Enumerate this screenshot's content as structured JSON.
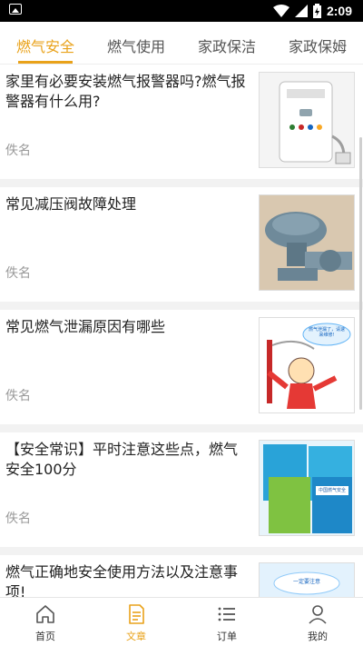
{
  "status_bar": {
    "time": "2:09"
  },
  "tabs": [
    {
      "label": "燃气安全",
      "active": true
    },
    {
      "label": "燃气使用",
      "active": false
    },
    {
      "label": "家政保洁",
      "active": false
    },
    {
      "label": "家政保姆",
      "active": false
    }
  ],
  "articles": [
    {
      "title": "家里有必要安装燃气报警器吗?燃气报警器有什么用?",
      "author": "佚名",
      "thumb": "gas-alarm-photo"
    },
    {
      "title": "常见减压阀故障处理",
      "author": "佚名",
      "thumb": "pressure-valve-photo"
    },
    {
      "title": "常见燃气泄漏原因有哪些",
      "author": "佚名",
      "thumb": "gas-leak-cartoon",
      "thumb_text": "燃气泄漏了，请速来维修!"
    },
    {
      "title": "【安全常识】平时注意这些点，燃气安全100分",
      "author": "佚名",
      "thumb": "safety-brochures-photo",
      "thumb_text": "中国燃气安全"
    },
    {
      "title": "燃气正确地安全使用方法以及注意事项!",
      "author": "",
      "thumb": "safety-cartoon",
      "thumb_text": "一定要注意"
    }
  ],
  "bottom_nav": [
    {
      "label": "首页",
      "icon": "home-icon",
      "active": false
    },
    {
      "label": "文章",
      "icon": "article-icon",
      "active": true
    },
    {
      "label": "订单",
      "icon": "list-icon",
      "active": false
    },
    {
      "label": "我的",
      "icon": "profile-icon",
      "active": false
    }
  ],
  "colors": {
    "accent": "#e9a21a",
    "background": "#f2f2f2"
  }
}
